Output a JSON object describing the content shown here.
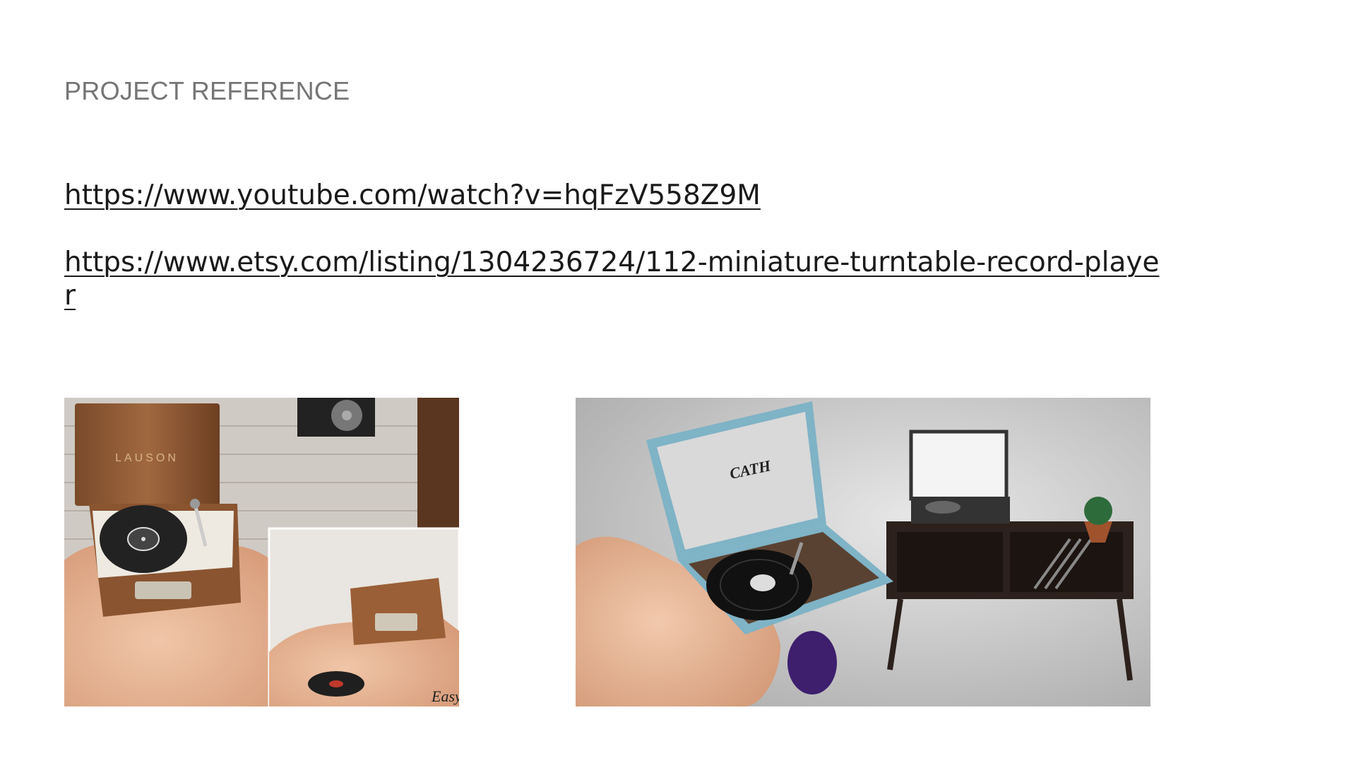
{
  "slide": {
    "title": "PROJECT REFERENCE",
    "links": [
      "https://www.youtube.com/watch?v=hqFzV558Z9M",
      "https://www.etsy.com/listing/1304236724/112-miniature-turntable-record-player"
    ]
  },
  "images": {
    "left": {
      "lid_brand": "LAUSON",
      "watermark": "Easy"
    },
    "right": {
      "lid_logo": "CATH"
    }
  }
}
